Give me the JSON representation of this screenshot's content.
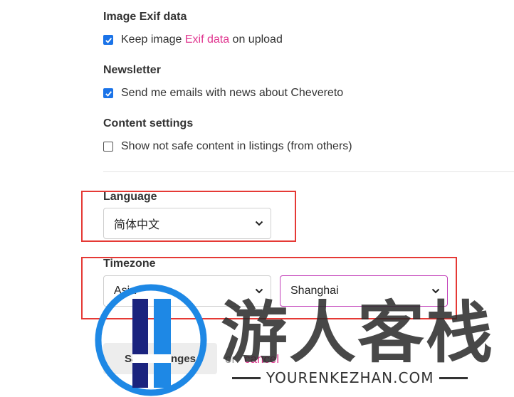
{
  "exif": {
    "title": "Image Exif data",
    "label_prefix": "Keep image ",
    "label_link": "Exif data",
    "label_suffix": " on upload",
    "checked": true
  },
  "newsletter": {
    "title": "Newsletter",
    "label": "Send me emails with news about Chevereto",
    "checked": true
  },
  "content": {
    "title": "Content settings",
    "label": "Show not safe content in listings (from others)",
    "checked": false
  },
  "language": {
    "title": "Language",
    "selected": "简体中文"
  },
  "timezone": {
    "title": "Timezone",
    "region": "Asia",
    "city": "Shanghai"
  },
  "actions": {
    "save_label": "Save changes",
    "or": "or",
    "cancel": "cancel"
  },
  "watermark": {
    "text": "游人客栈",
    "sub": "YOURENKEZHAN.COM"
  },
  "colors": {
    "accent": "#e0358f",
    "checkbox": "#1a73e8",
    "highlight_box": "#e53935"
  }
}
